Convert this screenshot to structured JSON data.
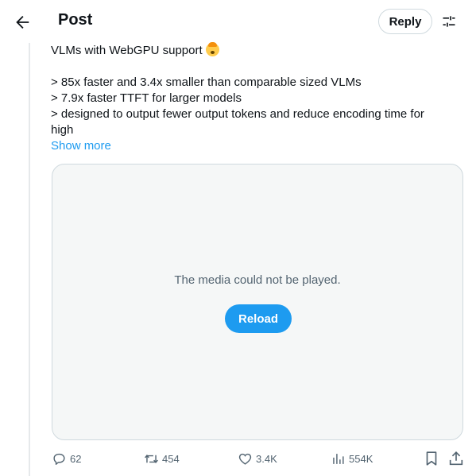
{
  "header": {
    "title": "Post",
    "reply_label": "Reply",
    "back_icon": "arrow-left-icon",
    "settings_icon": "sliders-icon"
  },
  "tweet": {
    "line1": "VLMs with WebGPU support",
    "emoji": "exploding-head-emoji",
    "bullets": [
      "> 85x faster and 3.4x smaller than comparable sized VLMs",
      "> 7.9x faster TTFT for larger models",
      "> designed to output fewer output tokens and reduce encoding time for",
      "high"
    ],
    "show_more": "Show more"
  },
  "media": {
    "message": "The media could not be played.",
    "reload_label": "Reload"
  },
  "actions": {
    "replies": "62",
    "reposts": "454",
    "likes": "3.4K",
    "views": "554K"
  },
  "colors": {
    "accent": "#1d9bf0",
    "muted_text": "#536471",
    "border": "#cfd9de",
    "media_bg": "#f5f7f7"
  }
}
